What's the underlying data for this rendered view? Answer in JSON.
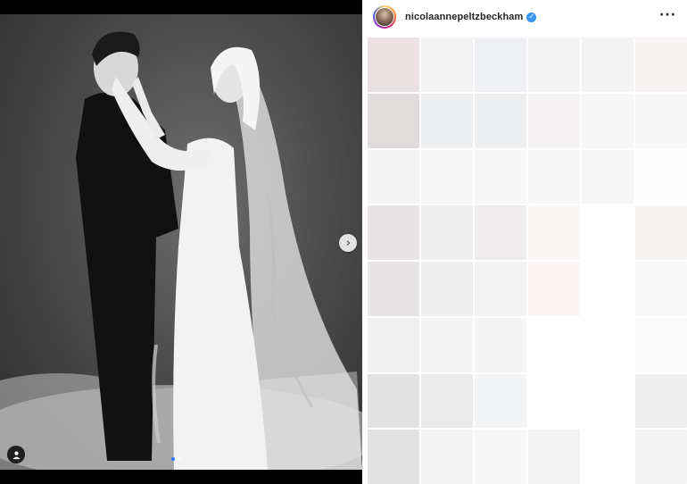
{
  "profile": {
    "username": "nicolaannepeltzbeckham",
    "verified": true
  },
  "icons": {
    "next": "chevron-right-icon",
    "more": "more-options-icon",
    "tag": "user-tag-icon",
    "verified": "verified-badge-icon"
  },
  "glyphs": {
    "next": "›",
    "more": "···",
    "check": "✓"
  },
  "carousel": {
    "total": 2,
    "current": 1
  },
  "colors": {
    "accent": "#3897f0",
    "active_dot": "#2f7cf6",
    "media_bg": "#000000"
  },
  "blurred_comment_colors": [
    "#eae1e3",
    "#f2f2f3",
    "#eef0f3",
    "#f3f3f3",
    "#f4f4f4",
    "#f8f4f3",
    "#dfdcdb",
    "#eceeef",
    "#eceef0",
    "#f4f2f3",
    "#f6f6f6",
    "#f8f7f7",
    "#f4f4f4",
    "#f6f6f6",
    "#f7f7f7",
    "#f7f7f8",
    "#f6f6f6",
    "#fdfdfd",
    "#e9e5e6",
    "#eeeeef",
    "#efeced",
    "#f9f6f6",
    "#ffffff",
    "#f7f4f4",
    "#e7e4e5",
    "#efeeee",
    "#f4f3f3",
    "#fbf6f5",
    "#ffffff",
    "#f8f8f8",
    "#f0f0f0",
    "#f4f4f4",
    "#f5f5f5",
    "#ffffff",
    "#ffffff",
    "#f9f9f9",
    "#e2e1e2",
    "#ebebec",
    "#f3f4f5",
    "#ffffff",
    "#ffffff",
    "#efefef",
    "#e3e2e3",
    "#f2f2f2",
    "#f7f7f7",
    "#f3f3f3",
    "#ffffff",
    "#f5f5f5"
  ]
}
